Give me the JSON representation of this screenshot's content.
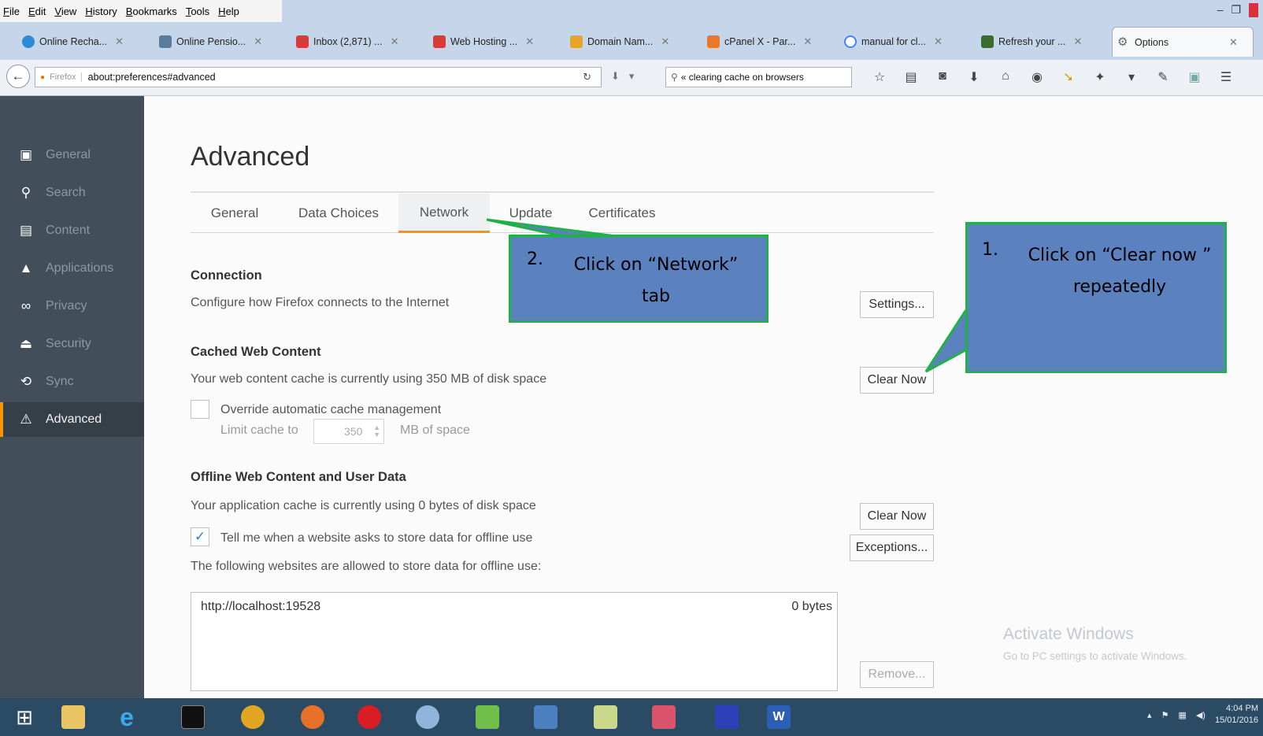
{
  "menubar": {
    "items": [
      "File",
      "Edit",
      "View",
      "History",
      "Bookmarks",
      "Tools",
      "Help"
    ]
  },
  "tabs": [
    {
      "label": "Online Recha...",
      "color": "#2d8ad6"
    },
    {
      "label": "Online Pensio...",
      "color": "#5a7c9c"
    },
    {
      "label": "Inbox (2,871) ...",
      "color": "#d93b3b"
    },
    {
      "label": "Web Hosting ...",
      "color": "#d93b3b"
    },
    {
      "label": "Domain Nam...",
      "color": "#e5a52b"
    },
    {
      "label": "cPanel X - Par...",
      "color": "#e9782a"
    },
    {
      "label": "manual for cl...",
      "color": "#4285f4"
    },
    {
      "label": "Refresh your ...",
      "color": "#3b6b2e"
    },
    {
      "label": "Options",
      "color": "#777777"
    }
  ],
  "navbar": {
    "firefox_label": "Firefox",
    "url": "about:preferences#advanced",
    "search_text": "« clearing cache on browsers"
  },
  "sidebar": {
    "items": [
      {
        "label": "General",
        "icon": "general-icon"
      },
      {
        "label": "Search",
        "icon": "search-icon"
      },
      {
        "label": "Content",
        "icon": "content-icon"
      },
      {
        "label": "Applications",
        "icon": "applications-icon"
      },
      {
        "label": "Privacy",
        "icon": "privacy-icon"
      },
      {
        "label": "Security",
        "icon": "security-icon"
      },
      {
        "label": "Sync",
        "icon": "sync-icon"
      },
      {
        "label": "Advanced",
        "icon": "advanced-icon"
      }
    ],
    "selected": "Advanced"
  },
  "main": {
    "title": "Advanced",
    "subtabs": [
      "General",
      "Data Choices",
      "Network",
      "Update",
      "Certificates"
    ],
    "active_subtab": "Network",
    "connection": {
      "title": "Connection",
      "desc": "Configure how Firefox connects to the Internet",
      "settings_button": "Settings..."
    },
    "cached": {
      "title": "Cached Web Content",
      "desc": "Your web content cache is currently using 350 MB of disk space",
      "clear_button": "Clear Now",
      "override_label": "Override automatic cache management",
      "limit_label": "Limit cache to",
      "limit_value": "350",
      "limit_unit": "MB of space"
    },
    "offline": {
      "title": "Offline Web Content and User Data",
      "desc": "Your application cache is currently using 0 bytes of disk space",
      "clear_button": "Clear Now",
      "tell_label": "Tell me when a website asks to store data for offline use",
      "exceptions_button": "Exceptions...",
      "allowed_desc": "The following websites are allowed to store data for offline use:",
      "sites": [
        {
          "url": "http://localhost:19528",
          "size": "0 bytes"
        }
      ],
      "remove_button": "Remove..."
    },
    "watermark": {
      "line1": "Activate Windows",
      "line2": "Go to PC settings to activate Windows."
    }
  },
  "callouts": {
    "first": {
      "num": "1.",
      "text": "Click on “Clear now ” repeatedly"
    },
    "second": {
      "num": "2.",
      "text": "Click on “Network” tab"
    }
  },
  "taskbar": {
    "clock_time": "4:04 PM",
    "clock_date": "15/01/2016"
  }
}
